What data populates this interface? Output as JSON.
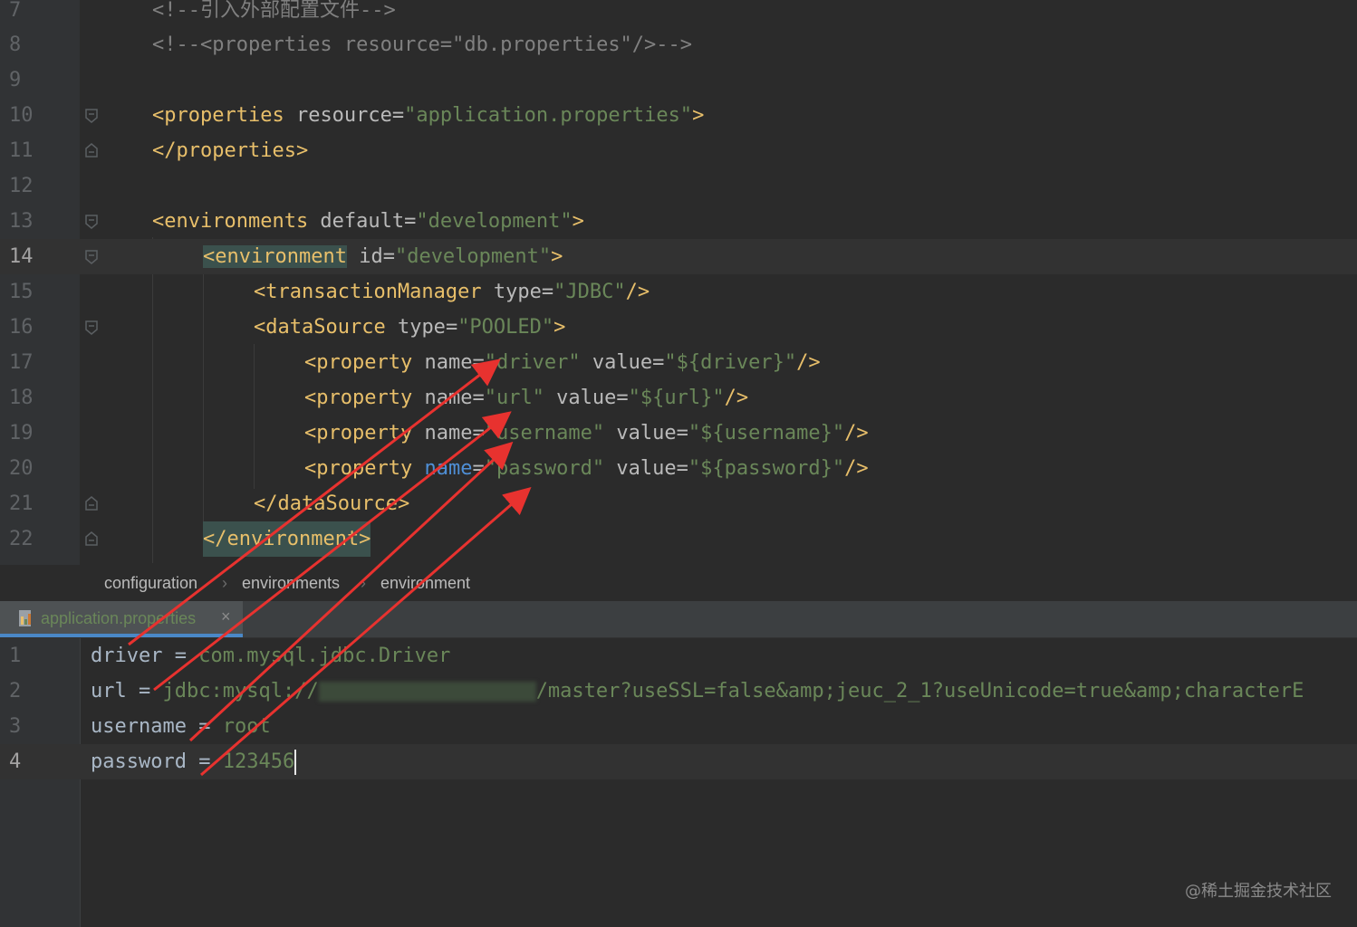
{
  "top_editor": {
    "lines": [
      {
        "num": "7",
        "text": "<!--引入外部配置文件-->"
      },
      {
        "num": "8",
        "text": "<!--<properties resource=\"db.properties\"/>-->"
      },
      {
        "num": "9",
        "text": ""
      },
      {
        "num": "10",
        "tag_open": "<properties",
        "attr": " resource",
        "eq": "=",
        "value": "\"application.properties\"",
        "close": ">"
      },
      {
        "num": "11",
        "text": "</properties>"
      },
      {
        "num": "12",
        "text": ""
      },
      {
        "num": "13",
        "tag_open": "<environments",
        "attr": " default",
        "eq": "=",
        "value": "\"development\"",
        "close": ">"
      },
      {
        "num": "14",
        "tag_open": "<environment",
        "attr": " id",
        "eq": "=",
        "value": "\"development\"",
        "close": ">"
      },
      {
        "num": "15",
        "tag_open": "<transactionManager",
        "attr": " type",
        "eq": "=",
        "value": "\"JDBC\"",
        "close": "/>"
      },
      {
        "num": "16",
        "tag_open": "<dataSource",
        "attr": " type",
        "eq": "=",
        "value": "\"POOLED\"",
        "close": ">"
      },
      {
        "num": "17",
        "tag_open": "<property",
        "attr": " name",
        "eq": "=",
        "value": "\"driver\"",
        "attr2": " value",
        "value2": "\"${driver}\"",
        "close": "/>"
      },
      {
        "num": "18",
        "tag_open": "<property",
        "attr": " name",
        "eq": "=",
        "value": "\"url\"",
        "attr2": " value",
        "value2": "\"${url}\"",
        "close": "/>"
      },
      {
        "num": "19",
        "tag_open": "<property",
        "attr": " name",
        "eq": "=",
        "value": "\"username\"",
        "attr2": " value",
        "value2": "\"${username}\"",
        "close": "/>"
      },
      {
        "num": "20",
        "tag_open": "<property",
        "attr": " name",
        "eq": "=",
        "value": "\"password\"",
        "attr2": " value",
        "value2": "\"${password}\"",
        "close": "/>"
      },
      {
        "num": "21",
        "text": "</dataSource>"
      },
      {
        "num": "22",
        "text": "</environment>"
      }
    ]
  },
  "breadcrumb": {
    "items": [
      "configuration",
      "environments",
      "environment"
    ],
    "separator": "›"
  },
  "tab": {
    "label": "application.properties",
    "close": "×",
    "icon": "properties-file-icon"
  },
  "bottom_editor": {
    "lines": [
      {
        "num": "1",
        "key": "driver",
        "eq": " = ",
        "value": "com.mysql.jdbc.Driver"
      },
      {
        "num": "2",
        "key": "url",
        "eq": " = ",
        "value_pre": "jdbc:mysql://",
        "value_post": "/master?useSSL=false&amp;jeuc_2_1?useUnicode=true&amp;characterE"
      },
      {
        "num": "3",
        "key": "username",
        "eq": " = ",
        "value": "root"
      },
      {
        "num": "4",
        "key": "password",
        "eq": " = ",
        "value": "123456"
      }
    ]
  },
  "watermark": "@稀土掘金技术社区",
  "colors": {
    "background": "#2b2b2b",
    "gutter": "#313335",
    "tag": "#e8bf6a",
    "value": "#6a8759",
    "arrow": "#e8322f",
    "tab_underline": "#4a88c7"
  }
}
